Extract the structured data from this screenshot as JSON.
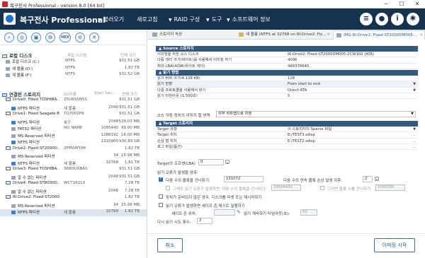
{
  "window": {
    "title": "복구전사 Professional - version 8.0 [64 bit]",
    "minimize": "─",
    "maximize": "☐",
    "close": "✕"
  },
  "topbar": {
    "app_title": "복구전사 Professional",
    "menu": [
      {
        "label": "불러오기"
      },
      {
        "label": "새로고침"
      },
      {
        "label": "RAID 구성"
      },
      {
        "label": "도구"
      },
      {
        "label": "소프트웨어 정보"
      }
    ],
    "arrow": "▼",
    "right_icons": [
      "menu-icon",
      "user-icon",
      "info-icon",
      "gear-icon"
    ]
  },
  "toolbar": {
    "buttons": [
      "search-icon",
      "scan-icon",
      "save-icon",
      "copy-icon",
      "hex-icon",
      "delete-icon",
      "close-icon"
    ],
    "hex_label": "HEX"
  },
  "local": {
    "title": "로컬 디스크",
    "col_fs": "파일 시스템",
    "col_size": "전체 크기",
    "rows": [
      {
        "name": "로컬 디스크 (C:)",
        "fs": "NTFS",
        "size": "931.51 GB"
      },
      {
        "name": "새 볼륨 (D:)",
        "fs": "NTFS",
        "size": "1.82 TB"
      },
      {
        "name": "새 볼륨 (F:)",
        "fs": "NTFS",
        "size": "931.52 GB"
      }
    ]
  },
  "connected": {
    "title": "연결된 스토리지",
    "col_id": "ID/이름",
    "col_start": "Start Sec...",
    "col_size": "전체 크기",
    "rows": [
      {
        "kind": "disk",
        "name": "Drive0: Fixed TOSHIBA...",
        "id": "Z5U6S5N5S",
        "start": "",
        "size": "931.51 GB"
      },
      {
        "kind": "part",
        "name": "NTFS 파티션",
        "id": "새 볼륨",
        "start": "2048",
        "size": "931.51 GB"
      },
      {
        "kind": "disk",
        "name": "Drive1: Fixed Seagate B...",
        "id": "TQ7002P9",
        "start": "",
        "size": "931.51 GB"
      },
      {
        "kind": "part",
        "name": "NTFS 파티션",
        "id": "복구",
        "start": "2048",
        "size": "529.03 MB"
      },
      {
        "kind": "part",
        "name": "FAT32 파티션",
        "id": "NO NAME",
        "start": "1085440",
        "size": "99.00 MB"
      },
      {
        "kind": "part",
        "name": "MS Reserved 파티션",
        "id": "",
        "start": "1288192",
        "size": "16.00 MB"
      },
      {
        "kind": "part",
        "name": "NTFS 파티션",
        "id": "",
        "start": "1320960",
        "size": "930.89 GB"
      },
      {
        "kind": "disk",
        "name": "Drive2: Fixed ST2000D...",
        "id": "ZFM04FDM",
        "start": "",
        "size": "1.82 TB"
      },
      {
        "kind": "part",
        "name": "MS Reserved 파티션",
        "id": "",
        "start": "34",
        "size": "15.98 MB"
      },
      {
        "kind": "part",
        "name": "NTFS 파티션",
        "id": "새 볼륨",
        "start": "32768",
        "size": "1.82 TB"
      },
      {
        "kind": "disk",
        "name": "Drive3: Fixed TOSHIBA...",
        "id": "368DUXBAS",
        "start": "",
        "size": "931.51 GB"
      },
      {
        "kind": "part",
        "name": "알 수 없는 파티션",
        "id": "",
        "start": "2048",
        "size": "931.51 GB"
      },
      {
        "kind": "disk",
        "name": "Drive4: Fixed ST8000D...",
        "id": "WCT1R1LX",
        "start": "",
        "size": "7.28 TB"
      },
      {
        "kind": "part",
        "name": "알 수 없는 파티션",
        "id": "",
        "start": "2048",
        "size": "7.28 TB"
      },
      {
        "kind": "disk",
        "name": "RI:Drive2: Fixed ST2000...",
        "id": "",
        "start": "",
        "size": "1.82 TB"
      },
      {
        "kind": "part",
        "name": "MS Reserved 파티션",
        "id": "",
        "start": "34",
        "size": "15.98 MB"
      },
      {
        "kind": "part",
        "name": "NTFS 파티션",
        "id": "새 볼륨",
        "start": "32768",
        "size": "1.82 TB"
      }
    ]
  },
  "tabs": [
    {
      "label": "스토리지 속성",
      "active": false
    },
    {
      "label": "새 볼륨 (NTFS at 32768 on RI:Drive2: Fix...",
      "active": false
    },
    {
      "label": "IMG:RI:Drive2: Fixed ST2000DM005-...",
      "active": true
    }
  ],
  "source": {
    "header": "Source 스토리지",
    "rows": [
      {
        "k": "이미징을 위한 소스 디스크",
        "v": "RI:Drive2: Fixed ST2000DM005-2CW102 (ATA)"
      },
      {
        "k": "다중 섹터 크기(바이트)를 사용해서 이미징 하기",
        "v": "4096"
      },
      {
        "k": "최대 LBA(4096-바이트 섹터)",
        "v": "488378645"
      }
    ]
  },
  "read": {
    "header": "읽기 방법",
    "rows": [
      {
        "k": "읽기 버퍼 크기(4,128 KB)",
        "v": "128",
        "dd": false
      },
      {
        "k": "읽기 방향",
        "v": "From start to end",
        "dd": true
      },
      {
        "k": "다중 프로토콜을 사용해서 읽기",
        "v": "Direct ATA",
        "dd": true
      },
      {
        "k": "읽기 타임아웃 (1,500초)",
        "v": "5",
        "dd": false
      }
    ]
  },
  "save_label": "소스 저장 장치의 이미지 할 영역:",
  "save_value": "외부 비트맵으로 지정",
  "target": {
    "header": "Target 스토리지",
    "rows": [
      {
        "k": "Target 유형",
        "v": "이 스토리지의 Sparse 파일"
      },
      {
        "k": "Target 위치",
        "v": "E:/TEST3.sdisp"
      },
      {
        "k": "손상 맵 위치",
        "v": "E:/TEST2.sdisp"
      },
      {
        "k": "로그 파일(옵션)",
        "v": ""
      }
    ]
  },
  "offset": {
    "label": "Target의 오프셋(LBA)",
    "value": "0"
  },
  "error": {
    "title": "읽기 오류가 발생할 경우:",
    "skip_label": "다음 수의 블록을 건너뛰기:",
    "skip_value": "131072",
    "consec_label": "다음 수의 연속 블록 손상 발생 이후:",
    "consec_value": "2",
    "fill_label": "그래도 읽기 오류가 발생하면, 다음 수의 블록을 건너뛰기:",
    "fill_value": "33554432",
    "after_label": "그러면 블록 수를 건너뛰기:",
    "after_value": "1000000",
    "unready_label": "장치가 준비되지 않은 경우, 디스크를 리셋 또는 재시작하기",
    "readbad_label": "읽기 오류가 발생하면 세이프 존 테스트 실행하기",
    "safezone_label": "세이프 존 위치:",
    "safezone_value": "",
    "retries_label": "읽기 계속하기 타임아웃(초):",
    "retries_value": "60",
    "repeat_label": "다시 읽기 시도 횟수:",
    "repeat_value": "2"
  },
  "buttons": {
    "cancel": "취소",
    "start": "이미징 시작"
  }
}
